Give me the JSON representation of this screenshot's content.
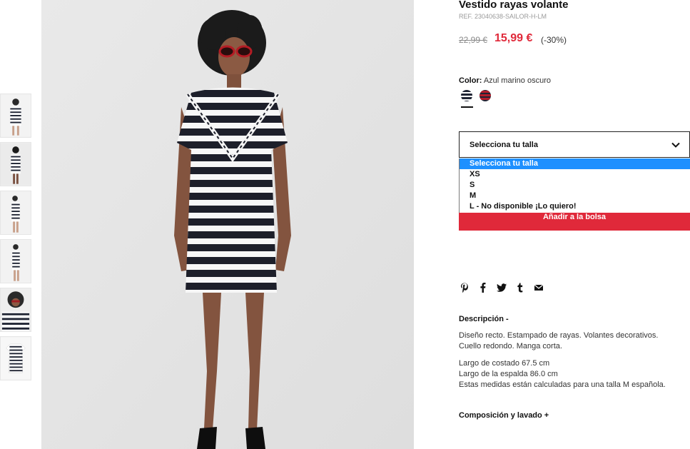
{
  "product": {
    "title": "Vestido rayas volante",
    "ref": "REF. 23040638-SAILOR-H-LM",
    "old_price": "22,99 €",
    "new_price": "15,99 €",
    "discount": "(-30%)"
  },
  "color": {
    "label": "Color:",
    "value": "Azul marino oscuro",
    "swatches": [
      "navy-white-stripes",
      "red-navy-stripes"
    ],
    "swatch_colors": [
      "#1f2433",
      "#b11e2c"
    ]
  },
  "size": {
    "placeholder": "Selecciona tu talla",
    "options": [
      "Selecciona tu talla",
      "XS",
      "S",
      "M",
      "L - No disponible ¡Lo quiero!"
    ],
    "selected_index": 0
  },
  "actions": {
    "add_to_bag": "Añadir a la bolsa"
  },
  "share_icons": [
    "pinterest-icon",
    "facebook-icon",
    "twitter-icon",
    "tumblr-icon",
    "email-icon"
  ],
  "description": {
    "title": "Descripción -",
    "lines": [
      "Diseño recto. Estampado de rayas. Volantes decorativos.",
      "Cuello redondo. Manga corta.",
      "Largo de costado 67.5 cm",
      "Largo de la espalda 86.0 cm",
      "Estas medidas están calculadas para una talla M española."
    ]
  },
  "composition": {
    "title": "Composición y lavado +"
  },
  "gallery": {
    "thumbnail_count": 6
  },
  "colors": {
    "accent": "#e0293a",
    "select_highlight": "#1e90ff",
    "photo_bg": "#ececec"
  }
}
